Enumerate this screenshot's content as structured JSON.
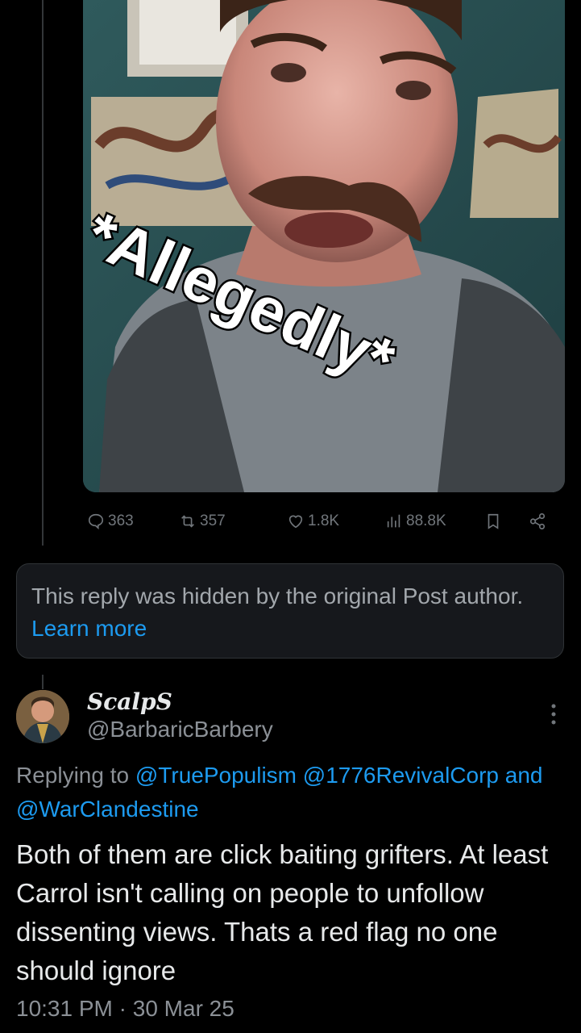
{
  "video": {
    "caption_lines": [
      "*Allegedly*"
    ]
  },
  "actions": {
    "replies": "363",
    "reposts": "357",
    "likes": "1.8K",
    "views": "88.8K"
  },
  "hidden_notice": {
    "text": "This reply was hidden by the original Post author.",
    "link": "Learn more"
  },
  "reply": {
    "display_name": "ScalpS",
    "handle": "@BarbaricBarbery",
    "replying_prefix": "Replying to",
    "mentions": [
      "@TruePopulism",
      "@1776RevivalCorp",
      "and",
      "@WarClandestine"
    ],
    "body": "Both of them are click baiting grifters. At least Carrol isn't calling on people to unfollow dissenting views. Thats a red flag no one should ignore",
    "time": "10:31 PM",
    "separator": "·",
    "date": "30 Mar 25"
  },
  "colors": {
    "background": "#000000",
    "text": "#e7e9ea",
    "muted": "#8b9096",
    "link": "#1d9bf0",
    "notice_bg": "#16181c"
  },
  "icons": [
    "reply-icon",
    "repost-icon",
    "like-icon",
    "views-icon",
    "bookmark-icon",
    "share-icon",
    "more-icon"
  ]
}
